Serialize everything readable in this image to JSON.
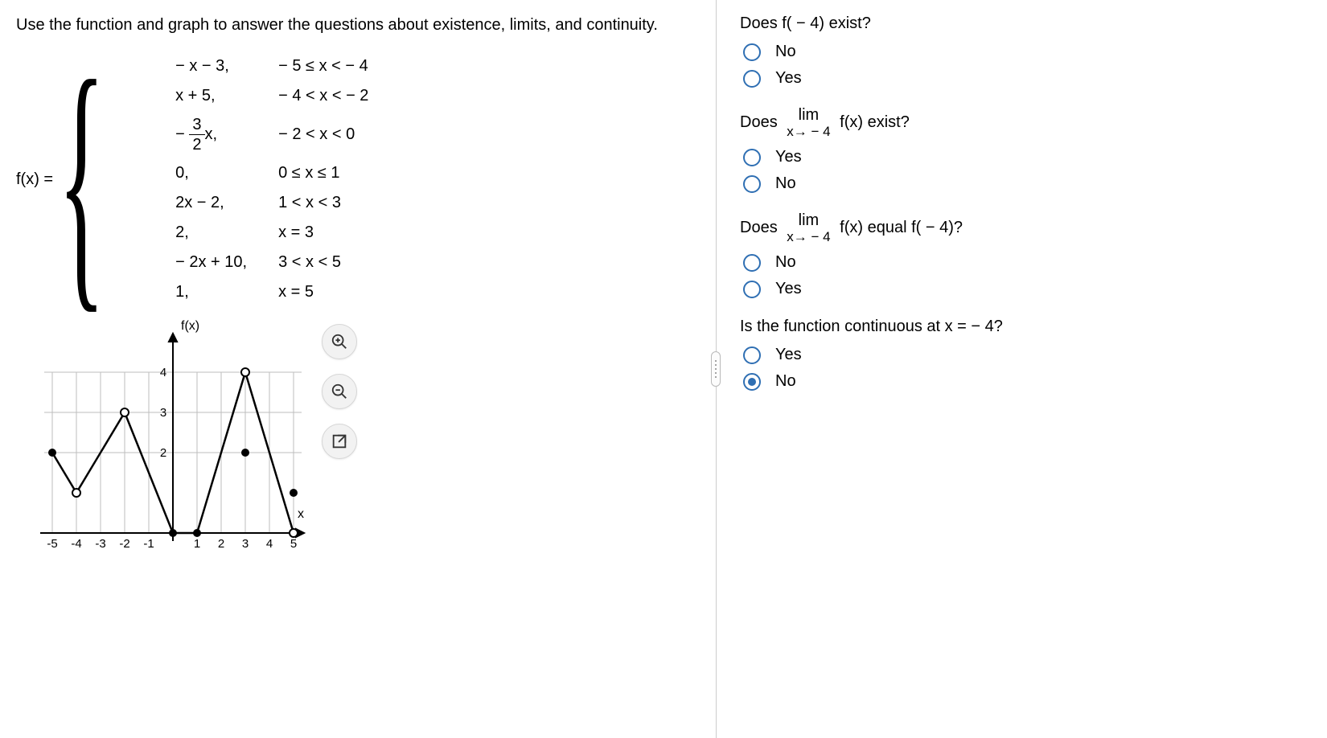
{
  "intro": "Use the function and graph to answer the questions about existence, limits, and continuity.",
  "fx_label": "f(x) = ",
  "piecewise": [
    {
      "expr": "− x − 3,",
      "cond": "− 5 ≤ x < − 4"
    },
    {
      "expr": "x + 5,",
      "cond": "− 4 < x < − 2"
    },
    {
      "expr": "FRAC_-3/2_x",
      "cond": "− 2 < x < 0"
    },
    {
      "expr": "0,",
      "cond": "0 ≤ x ≤ 1"
    },
    {
      "expr": "2x − 2,",
      "cond": "1 < x < 3"
    },
    {
      "expr": "2,",
      "cond": "x = 3"
    },
    {
      "expr": "− 2x + 10,",
      "cond": "3 < x < 5"
    },
    {
      "expr": "1,",
      "cond": "x = 5"
    }
  ],
  "frac_neg_three_half": {
    "prefix": "− ",
    "num": "3",
    "den": "2",
    "suffix": "x,"
  },
  "questions": {
    "q1": {
      "text": "Does f( − 4) exist?",
      "opts": [
        "No",
        "Yes"
      ],
      "selected": -1
    },
    "q2": {
      "prefix": "Does ",
      "lim_top": "lim",
      "lim_bot": "x→ − 4",
      "suffix": " f(x) exist?",
      "opts": [
        "Yes",
        "No"
      ],
      "selected": -1
    },
    "q3": {
      "prefix": "Does ",
      "lim_top": "lim",
      "lim_bot": "x→ − 4",
      "suffix": " f(x) equal f( − 4)?",
      "opts": [
        "No",
        "Yes"
      ],
      "selected": -1
    },
    "q4": {
      "text": "Is the function continuous at x = − 4?",
      "opts": [
        "Yes",
        "No"
      ],
      "selected": 1
    }
  },
  "graph": {
    "fx_label": "f(x)",
    "x_label": "x"
  },
  "chart_data": {
    "type": "line",
    "title": "",
    "xlabel": "x",
    "ylabel": "f(x)",
    "xlim": [
      -5.5,
      5.5
    ],
    "ylim": [
      -0.5,
      5
    ],
    "xticks": [
      -5,
      -4,
      -3,
      -2,
      -1,
      1,
      2,
      3,
      4,
      5
    ],
    "yticks": [
      2,
      3,
      4
    ],
    "series": [
      {
        "name": "piece1",
        "x": [
          -5,
          -4
        ],
        "y": [
          2,
          1
        ],
        "endpoints": {
          "left": "closed",
          "right": "open"
        }
      },
      {
        "name": "piece2",
        "x": [
          -4,
          -2
        ],
        "y": [
          1,
          3
        ],
        "endpoints": {
          "left": "open",
          "right": "open"
        }
      },
      {
        "name": "piece3",
        "x": [
          -2,
          0
        ],
        "y": [
          3,
          0
        ],
        "endpoints": {
          "left": "open",
          "right": "closed"
        }
      },
      {
        "name": "piece4",
        "x": [
          0,
          1
        ],
        "y": [
          0,
          0
        ],
        "endpoints": {
          "left": "closed",
          "right": "closed"
        }
      },
      {
        "name": "piece5",
        "x": [
          1,
          3
        ],
        "y": [
          0,
          4
        ],
        "endpoints": {
          "left": "open",
          "right": "open"
        }
      },
      {
        "name": "piece6_pt",
        "x": [
          3
        ],
        "y": [
          2
        ],
        "point": "closed"
      },
      {
        "name": "piece7",
        "x": [
          3,
          5
        ],
        "y": [
          4,
          0
        ],
        "endpoints": {
          "left": "open",
          "right": "open"
        }
      },
      {
        "name": "piece8_pt",
        "x": [
          5
        ],
        "y": [
          1
        ],
        "point": "closed"
      }
    ]
  }
}
